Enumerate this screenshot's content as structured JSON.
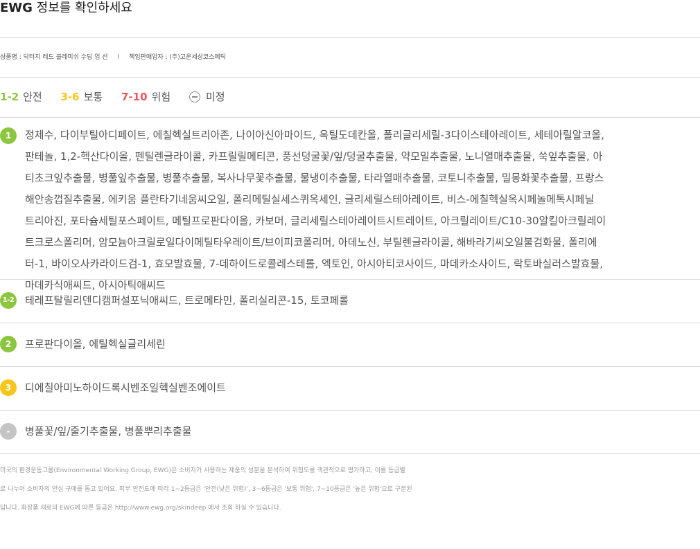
{
  "header": {
    "title_en": "EWG",
    "title_ko": " 정보를 확인하세요"
  },
  "info": {
    "product_label": "상품명 : 닥터지 레드 블레미쉬 수딩 업 선",
    "separator": "l",
    "seller_label": "책임판매업자 : (주)고운세상코스메틱"
  },
  "legend": {
    "items": [
      {
        "range": "1-2",
        "label": "안전",
        "color": "#8cc63f"
      },
      {
        "range": "3-6",
        "label": "보통",
        "color": "#f7c61b"
      },
      {
        "range": "7-10",
        "label": "위험",
        "color": "#e8585a"
      }
    ],
    "undetermined": {
      "icon": "minus-circle-icon",
      "label": "미정"
    }
  },
  "groups": [
    {
      "badge": "1",
      "color": "#8cc63f",
      "lines": [
        "정제수, 다이부틸아디페이트, 에칠헥실트리아존, 나이아신아마이드, 옥틸도데칸올, 폴리글리세릴-3다이스테아레이트, 세테아릴알코올,",
        "판테놀, 1,2-헥산다이올, 펜틸렌글라이콜, 카프릴릴메티콘, 풍선덩굴꽃/잎/덩굴추출물, 약모밀추출물, 노니열매추출물, 쑥잎추출물, 아",
        "티초크잎추출물, 병풀잎추출물, 병풀추출물, 복사나무꽃추출물, 물냉이추출물, 타라열매추출물, 코토니추출물, 밀몽화꽃추출물, 프랑스",
        "해안송껍질추출물, 에키움 플란타기네움씨오일, 폴리메틸실세스퀴옥세인, 글리세릴스테아레이트, 비스-에칠헥실옥시페놀메톡시페닐",
        "트리아진, 포타슘세틸포스페이트, 메틸프로판다이올, 카보머, 글리세릴스테아레이트시트레이트, 아크릴레이트/C10-30알킬아크릴레이",
        "트크로스폴리머, 암모늄아크릴로일다이메틸타우레이트/브이피코폴리머, 아데노신, 부틸렌글라이콜, 해바라기씨오일불검화물, 폴리에",
        "터-1, 바이오사카라이드검-1, 효모발효물, 7-데하이드로콜레스테롤, 엑토인, 아시아티코사이드, 마데카소사이드, 락토바실러스발효물,",
        "마데카식애씨드, 아시아틱애씨드"
      ]
    },
    {
      "badge": "1-2",
      "color": "#8cc63f",
      "text": "테레프탈릴리덴디캠퍼설포닉애씨드, 트로메타민, 폴리실리콘-15, 토코페롤"
    },
    {
      "badge": "2",
      "color": "#8cc63f",
      "text": "프로판다이올, 에틸헥실글리세린"
    },
    {
      "badge": "3",
      "color": "#f7c61b",
      "text": "디에칠아미노하이드록시벤조일헥실벤조에이트"
    },
    {
      "badge": "-",
      "color": "#c4c4c4",
      "text": "병풀꽃/잎/줄기추출물, 병풀뿌리추출물"
    }
  ],
  "footer": {
    "lines": [
      "미국의 환경운동그룹(Environmental Working Group, EWG)은 소비자가 사용하는 제품의 성분을 분석하여 위험도를 객관적으로 평가하고, 이를 등급별",
      "로 나누어 소비자의 안심 구매를 돕고 있어요. 피부 안전도에 따라 1~2등급은 '안전(낮은 위험)', 3~6등급은 '보통 위험', 7~10등급은 '높은 위험'으로 구분된",
      "답니다. 화장품 재료의 EWG에 따른 등급은 http://www.ewg.org/skindeep 에서 조회 하실 수 있습니다."
    ]
  }
}
